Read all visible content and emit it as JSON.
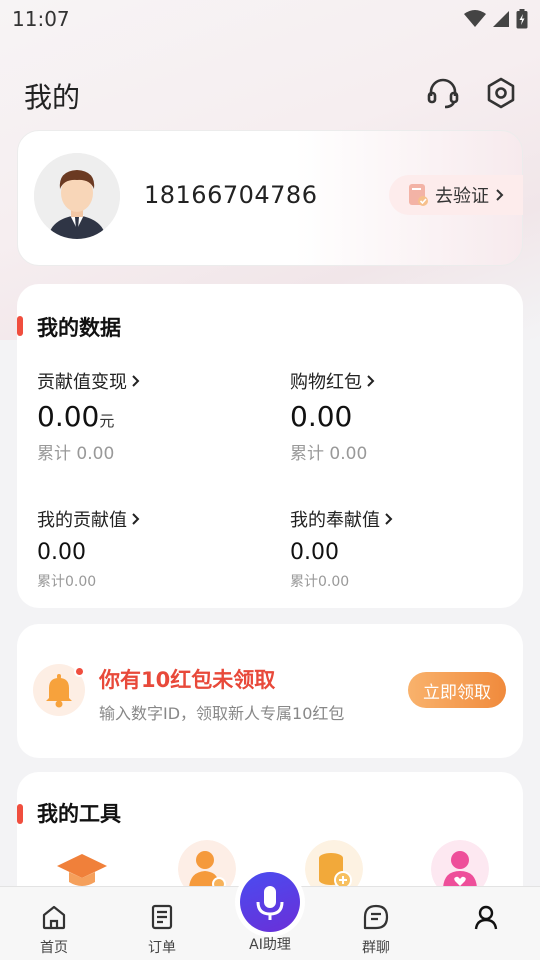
{
  "status_bar": {
    "time": "11:07"
  },
  "header": {
    "title": "我的",
    "icons": [
      "headset-icon",
      "settings-hex-icon"
    ]
  },
  "profile": {
    "phone": "18166704786",
    "verify_label": "去验证",
    "verify_icon": "id-card-icon"
  },
  "my_data": {
    "title": "我的数据",
    "stats": [
      {
        "label": "贡献值变现",
        "value": "0.00",
        "unit": "元",
        "total": "累计 0.00"
      },
      {
        "label": "购物红包",
        "value": "0.00",
        "unit": "",
        "total": "累计 0.00"
      },
      {
        "label": "我的贡献值",
        "value": "0.00",
        "unit": "",
        "total": "累计0.00"
      },
      {
        "label": "我的奉献值",
        "value": "0.00",
        "unit": "",
        "total": "累计0.00"
      }
    ]
  },
  "promo": {
    "title": "你有10红包未领取",
    "subtitle": "输入数字ID，领取新人专属10红包",
    "button": "立即领取",
    "icon": "bell-icon"
  },
  "tools": {
    "title": "我的工具",
    "icons": [
      "graduation-cap-icon",
      "user-settings-icon",
      "coins-icon",
      "user-heart-icon"
    ]
  },
  "tabbar": {
    "items": [
      {
        "label": "首页",
        "icon": "home-icon"
      },
      {
        "label": "订单",
        "icon": "document-icon"
      },
      {
        "label": "AI助理",
        "icon": "microphone-icon"
      },
      {
        "label": "群聊",
        "icon": "chat-icon"
      },
      {
        "label": "",
        "icon": "profile-icon"
      }
    ]
  },
  "colors": {
    "accent_red": "#f04e3e",
    "promo_orange": "#f08a3c",
    "mic_purple": "#5a3ee6"
  }
}
